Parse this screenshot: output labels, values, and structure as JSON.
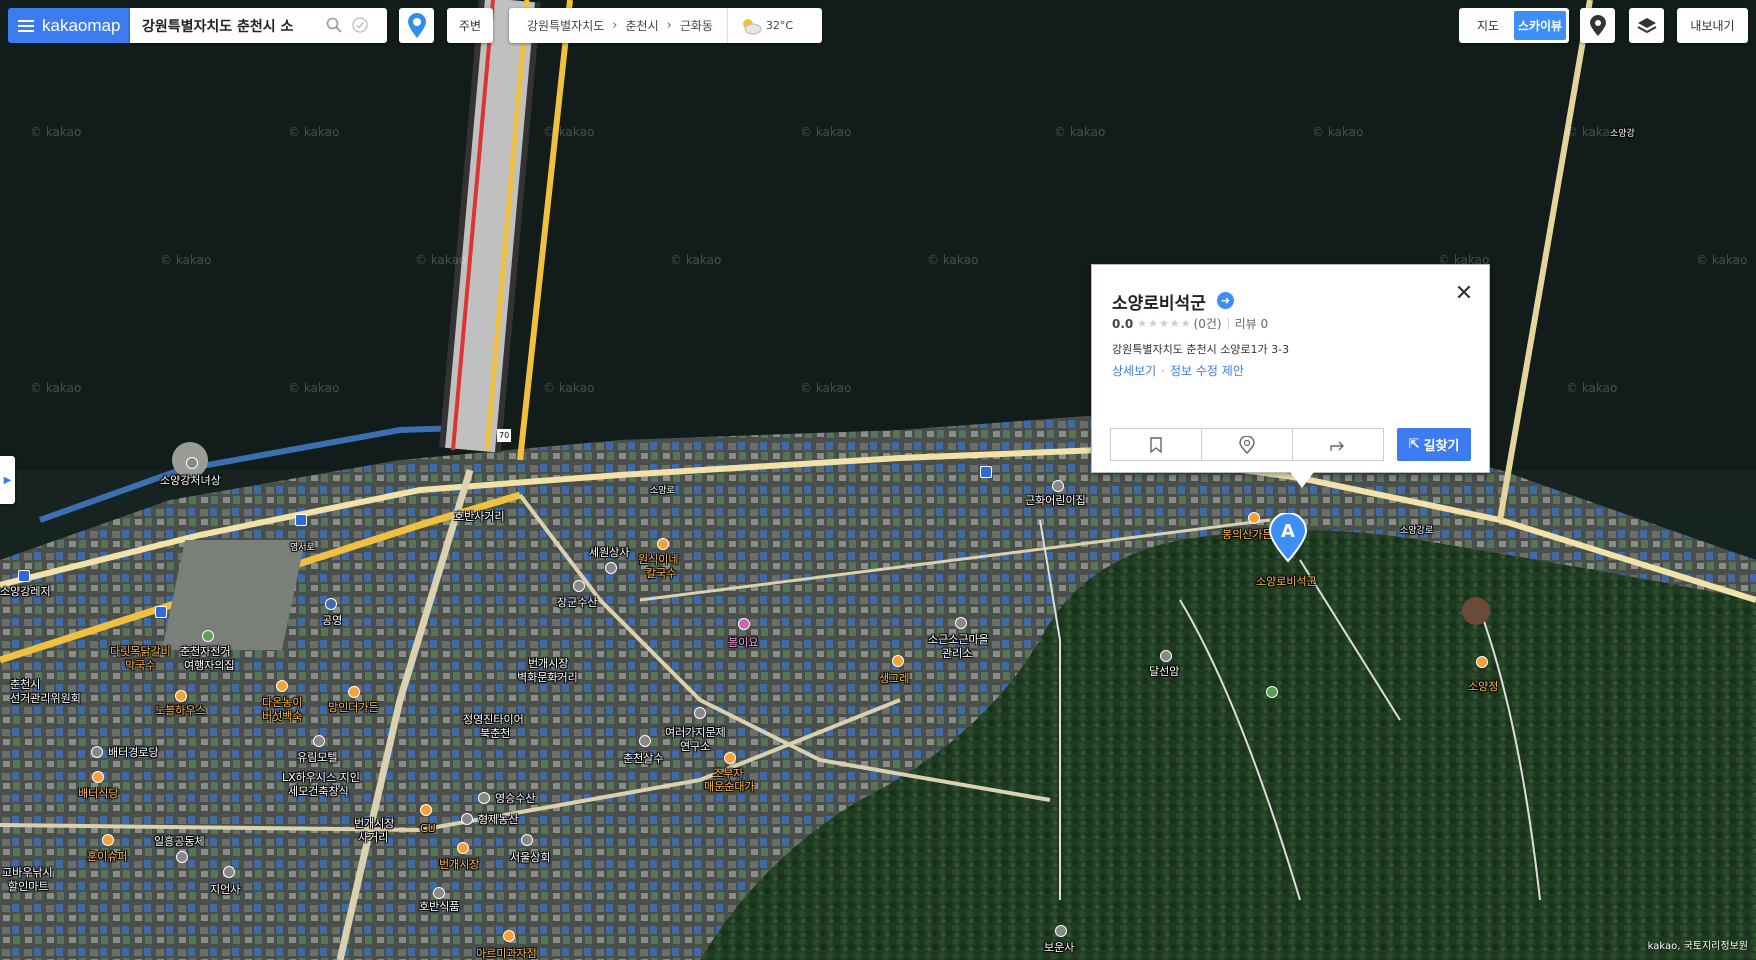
{
  "app": {
    "logo_text": "kakaomap"
  },
  "search": {
    "value": "강원특별자치도 춘천시 소"
  },
  "toolbar": {
    "nearby_label": "주변",
    "export_label": "내보내기"
  },
  "breadcrumb": {
    "level1": "강원특별자치도",
    "level2": "춘천시",
    "level3": "근화동"
  },
  "weather": {
    "temp": "32°C",
    "icon": "partly-cloudy-icon"
  },
  "view_toggle": {
    "map_label": "지도",
    "sky_label": "스카이뷰",
    "active": "스카이뷰"
  },
  "popup": {
    "title": "소양로비석군",
    "rating": "0.0",
    "rating_count": "(0건)",
    "review": "리뷰 0",
    "address": "강원특별자치도 춘천시 소양로1가 3-3",
    "link_detail": "상세보기",
    "link_edit": "정보 수정 제안",
    "route_label": "길찾기"
  },
  "marker": {
    "label": "A",
    "color": "#3d8ef7"
  },
  "watermark": "© kakao",
  "copyright": "kakao, 국토지리정보원",
  "map_labels": {
    "soyang_cheonyeosang": "소양강처녀상",
    "soyang_lejeo": "소양강레저",
    "hobansageori": "호반사거리",
    "sewon": "세원상사",
    "wonsik": "원식이네",
    "kalguksu": "칼국수",
    "jangkun": "장군수산",
    "gonghwa": "근화어린이집",
    "bongui": "봉의산가든",
    "soyangrobiseok": "소양로비석군",
    "dalseonam": "달선암",
    "soyangjeong": "소양정",
    "soyanggang": "소양강",
    "bomiyo": "봄이요",
    "sogeun1": "소근소근마을",
    "sogeun2": "관리소",
    "saenggeure": "생그레",
    "beongae1": "번개시장",
    "beongae2": "벽화문화거리",
    "jeongyeong1": "정영진타이어",
    "jeongyeong2": "북춘천",
    "yeoreo1": "여러가지문제",
    "yeoreo2": "연구소",
    "chuncheonsalsu": "춘천살수",
    "jobuja1": "조부자",
    "jobuja2": "매운순대가",
    "yeongseung": "영승수산",
    "hyeongje": "형제농산",
    "seoulsanghoe": "서울상회",
    "beongaesijang2": "번개시장",
    "hobansikpum": "호반식품",
    "arumi": "아르미과자점",
    "boun": "보운사",
    "jieonsa": "지언사",
    "ilheung": "일흥공동체",
    "huniseu": "훈이슈퍼",
    "gobangu1": "고바우낚시",
    "gobangu2": "할인마트",
    "beongaesijang_inter1": "번개시장",
    "beongaesijang_inter2": "사거리",
    "cu": "CU",
    "lxha1": "LX하우시스 지인",
    "lxha2": "세모건축창식",
    "yurim": "유림모텔",
    "baeteo": "배터경로당",
    "baeteosikdang": "배터식당",
    "noble": "노블하우스",
    "daongi1": "다온농이",
    "daongi2": "버섯백숙",
    "mangin": "망인더가든",
    "chuncheon_sel1": "춘천시",
    "chuncheon_sel2": "선거관리위원회",
    "chuncheonjeongeo1": "춘천자전거",
    "chuncheonjeongeo2": "여행자의집",
    "dadak": "다릿목닭갈비",
    "yakguksu": "막국수",
    "gongyeong": "공영",
    "yeongseo": "영서로",
    "soyangro": "소양로",
    "soyanggangro": "소양강로",
    "route70": "70"
  }
}
